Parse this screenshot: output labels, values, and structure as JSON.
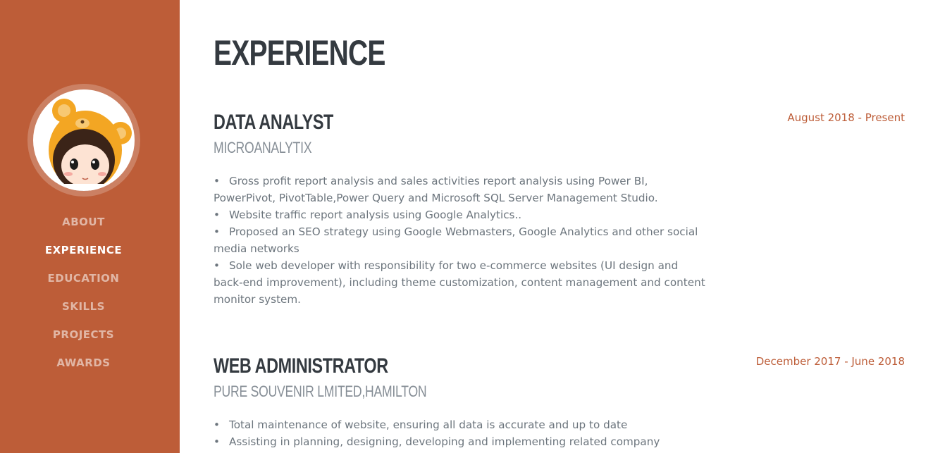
{
  "sidebar": {
    "nav": [
      {
        "label": "ABOUT",
        "active": false
      },
      {
        "label": "EXPERIENCE",
        "active": true
      },
      {
        "label": "EDUCATION",
        "active": false
      },
      {
        "label": "SKILLS",
        "active": false
      },
      {
        "label": "PROJECTS",
        "active": false
      },
      {
        "label": "AWARDS",
        "active": false
      }
    ],
    "accent_color": "#bd5d38"
  },
  "main": {
    "title": "EXPERIENCE",
    "jobs": [
      {
        "title": "DATA ANALYST",
        "company": "MICROANALYTIX",
        "dates": "August 2018 - Present",
        "bullets": [
          "Gross profit report analysis and sales activities report analysis using Power BI, PowerPivot, PivotTable,Power Query and Microsoft SQL Server Management Studio.",
          "Website traffic report analysis using Google Analytics..",
          "Proposed an SEO strategy using Google Webmasters, Google Analytics and other social media networks",
          "Sole web developer with responsibility for two e-commerce websites (UI design and back-end improvement), including theme customization, content management and content monitor system."
        ]
      },
      {
        "title": "WEB ADMINISTRATOR",
        "company": "PURE SOUVENIR LMITED,HAMILTON",
        "dates": "December 2017 - June 2018",
        "bullets": [
          "Total maintenance of website, ensuring all data is accurate and up to date",
          "Assisting in planning, designing, developing and implementing related company websites."
        ]
      }
    ]
  }
}
